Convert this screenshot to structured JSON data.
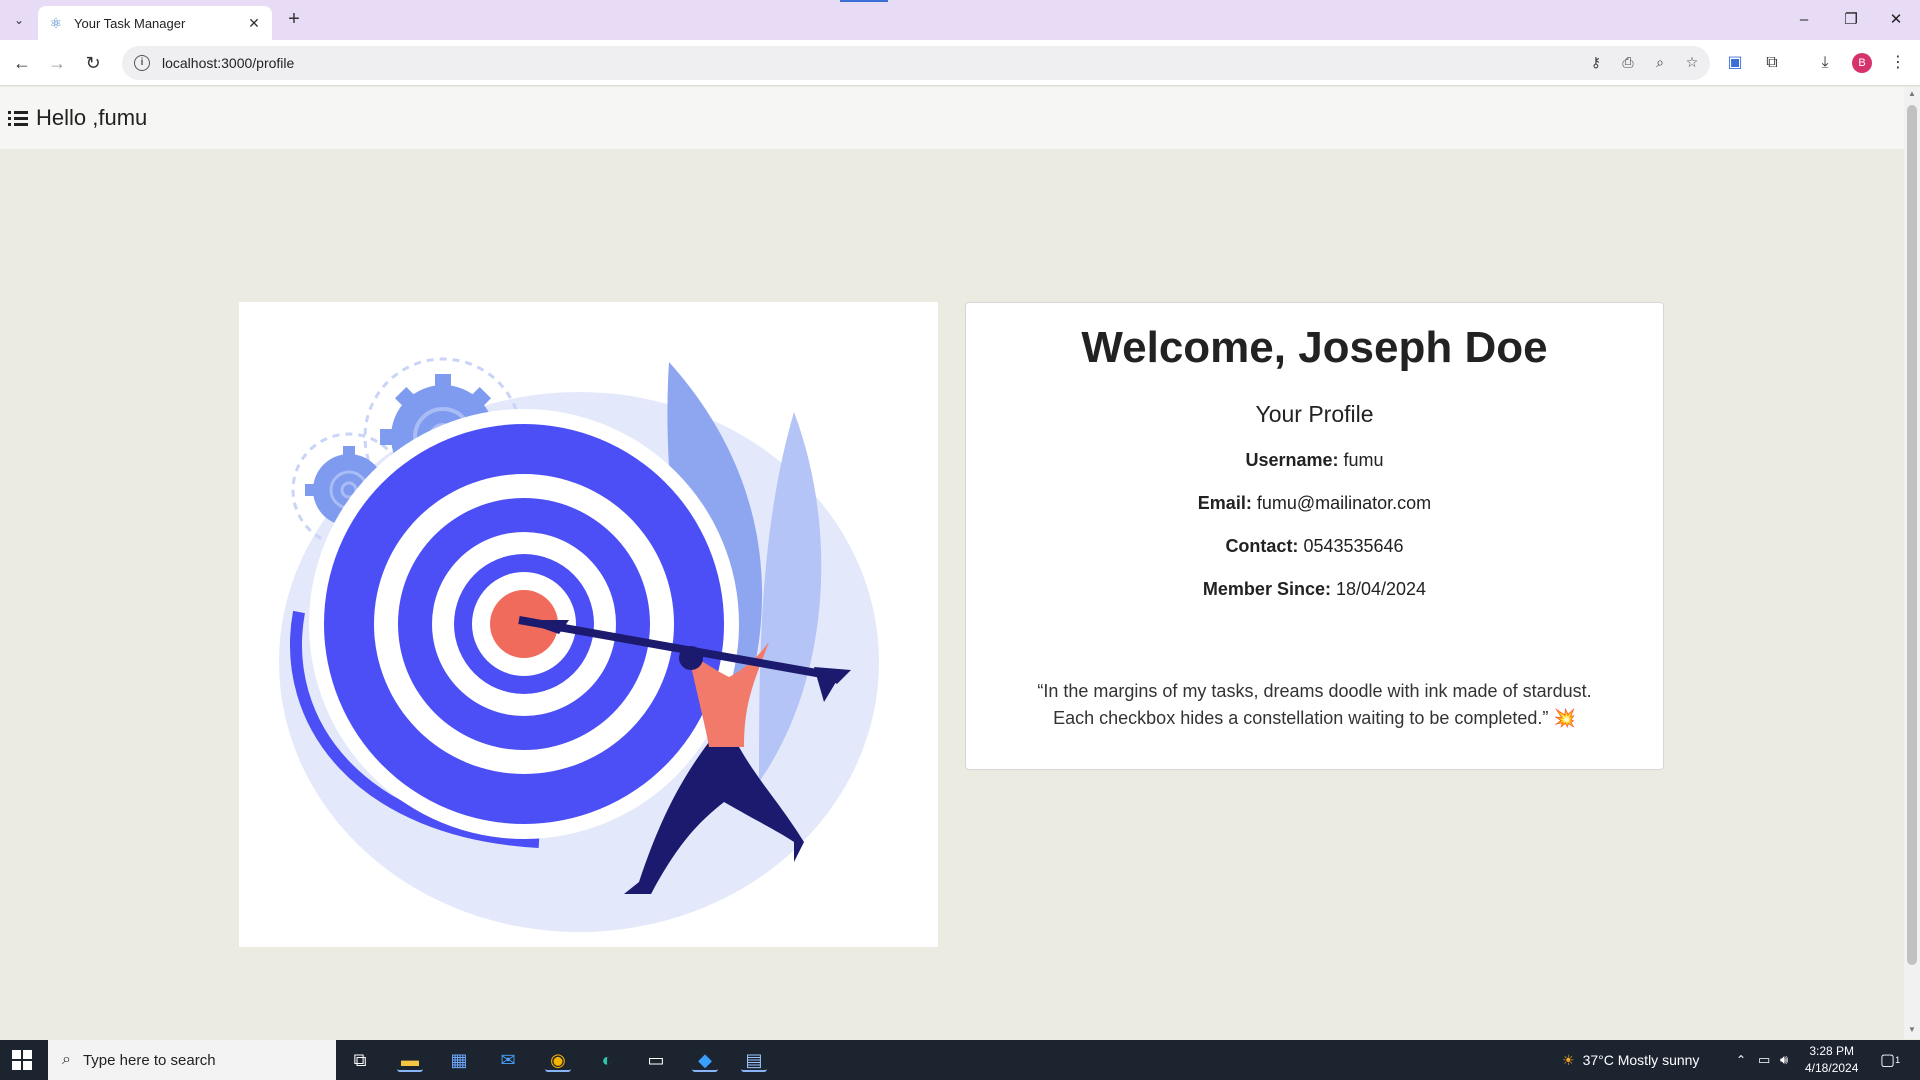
{
  "browser": {
    "tab_title": "Your Task Manager",
    "url": "localhost:3000/profile",
    "profile_initial": "B"
  },
  "app": {
    "greeting": "Hello ,fumu"
  },
  "profile": {
    "welcome": "Welcome, Joseph Doe",
    "subtitle": "Your Profile",
    "username_label": "Username:",
    "username": "fumu",
    "email_label": "Email:",
    "email": "fumu@mailinator.com",
    "contact_label": "Contact:",
    "contact": "0543535646",
    "member_since_label": "Member Since:",
    "member_since": "18/04/2024",
    "quote_line1": "“In the margins of my tasks, dreams doodle with ink made of stardust.",
    "quote_line2": "Each checkbox hides a constellation waiting to be completed.”",
    "quote_emoji": "💥"
  },
  "taskbar": {
    "search_placeholder": "Type here to search",
    "weather": "37°C  Mostly sunny",
    "time": "3:28 PM",
    "date": "4/18/2024",
    "notification_count": "1"
  },
  "colors": {
    "page_bg": "#ecebe2",
    "target_blue": "#4b4ff5",
    "target_red": "#f06b5b",
    "tabbar_bg": "#e8dbf6"
  }
}
